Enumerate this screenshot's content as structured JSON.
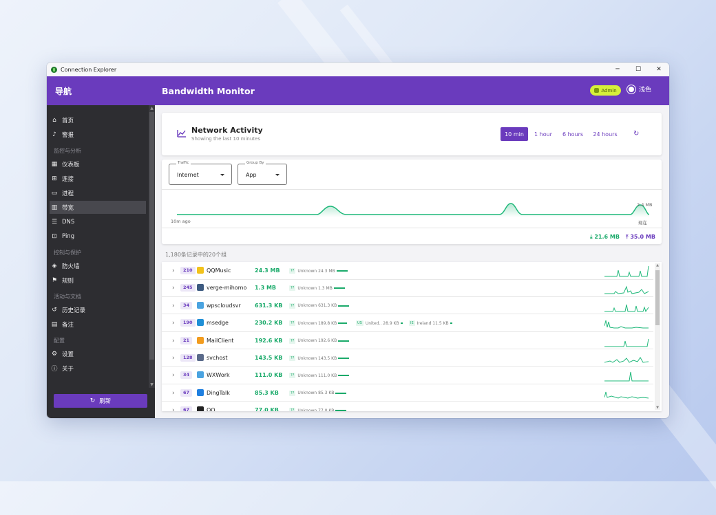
{
  "window": {
    "title": "Connection Explorer",
    "controls": [
      "─",
      "☐",
      "✕"
    ]
  },
  "sidebar": {
    "header": "导航",
    "items": [
      {
        "label": "首页",
        "icon": "home-icon"
      },
      {
        "label": "警报",
        "icon": "bell-icon"
      },
      {
        "section": "监控与分析"
      },
      {
        "label": "仪表板",
        "icon": "dashboard-icon"
      },
      {
        "label": "连接",
        "icon": "network-icon"
      },
      {
        "label": "进程",
        "icon": "window-icon"
      },
      {
        "label": "带宽",
        "icon": "bar-chart-icon",
        "active": true
      },
      {
        "label": "DNS",
        "icon": "dns-icon"
      },
      {
        "label": "Ping",
        "icon": "ping-icon"
      },
      {
        "section": "控制与保护"
      },
      {
        "label": "防火墙",
        "icon": "shield-icon"
      },
      {
        "label": "规则",
        "icon": "rules-icon"
      },
      {
        "section": "活动与文档"
      },
      {
        "label": "历史记录",
        "icon": "history-icon"
      },
      {
        "label": "备注",
        "icon": "note-icon"
      },
      {
        "section": "配置"
      },
      {
        "label": "设置",
        "icon": "gear-icon"
      },
      {
        "label": "关于",
        "icon": "info-icon"
      }
    ],
    "refresh_label": "刷新"
  },
  "header": {
    "title": "Bandwidth Monitor",
    "admin_label": "Admin",
    "theme_label": "浅色"
  },
  "activity": {
    "title": "Network Activity",
    "subtitle": "Showing the last 10 minutes",
    "ranges": [
      "10 min",
      "1 hour",
      "6 hours",
      "24 hours"
    ],
    "active_range": "10 min"
  },
  "filters": {
    "traffic": {
      "label": "Traffic",
      "value": "Internet"
    },
    "group_by": {
      "label": "Group By",
      "value": "App"
    }
  },
  "graph": {
    "x_start_label": "10m ago",
    "x_end_label": "现在",
    "y_max_label": "2.4 MB",
    "download_total": "21.6 MB",
    "upload_total": "35.0 MB",
    "line_color": "#1fb87a",
    "upload_color": "#6a3bbd"
  },
  "groups_caption": "1,180条记录中的20个组",
  "rows": [
    {
      "count": "210",
      "name": "QQMusic",
      "size": "24.3 MB",
      "icon_color": "#f2c21b",
      "chips": [
        {
          "tag": "??",
          "text": "Unknown 24.3 MB",
          "fill": 1.0
        }
      ]
    },
    {
      "count": "245",
      "name": "verge-mihomo",
      "size": "1.3 MB",
      "icon_color": "#3d5a80",
      "chips": [
        {
          "tag": "??",
          "text": "Unknown 1.3 MB",
          "fill": 1.0
        }
      ]
    },
    {
      "count": "34",
      "name": "wpscloudsvr",
      "size": "631.3 KB",
      "icon_color": "#4aa3e0",
      "chips": [
        {
          "tag": "??",
          "text": "Unknown 631.3 KB",
          "fill": 1.0
        }
      ]
    },
    {
      "count": "190",
      "name": "msedge",
      "size": "230.2 KB",
      "icon_color": "#1f8fd6",
      "chips": [
        {
          "tag": "??",
          "text": "Unknown 189.8 KB",
          "fill": 0.82
        },
        {
          "tag": "US",
          "text": "United.. 28.9 KB",
          "fill": 0.13
        },
        {
          "tag": "IE",
          "text": "Ireland 11.5 KB",
          "fill": 0.05
        }
      ]
    },
    {
      "count": "21",
      "name": "MailClient",
      "size": "192.6 KB",
      "icon_color": "#f29c1f",
      "chips": [
        {
          "tag": "??",
          "text": "Unknown 192.6 KB",
          "fill": 1.0
        }
      ]
    },
    {
      "count": "128",
      "name": "svchost",
      "size": "143.5 KB",
      "icon_color": "#5a6a8a",
      "chips": [
        {
          "tag": "??",
          "text": "Unknown 143.5 KB",
          "fill": 1.0
        }
      ]
    },
    {
      "count": "34",
      "name": "WXWork",
      "size": "111.0 KB",
      "icon_color": "#4aa3e0",
      "chips": [
        {
          "tag": "??",
          "text": "Unknown 111.0 KB",
          "fill": 1.0
        }
      ]
    },
    {
      "count": "67",
      "name": "DingTalk",
      "size": "85.3 KB",
      "icon_color": "#1f7fe0",
      "chips": [
        {
          "tag": "??",
          "text": "Unknown 85.3 KB",
          "fill": 1.0
        }
      ]
    },
    {
      "count": "67",
      "name": "QQ",
      "size": "77.0 KB",
      "icon_color": "#222222",
      "chips": [
        {
          "tag": "??",
          "text": "Unknown 77.0 KB",
          "fill": 1.0
        }
      ]
    }
  ]
}
